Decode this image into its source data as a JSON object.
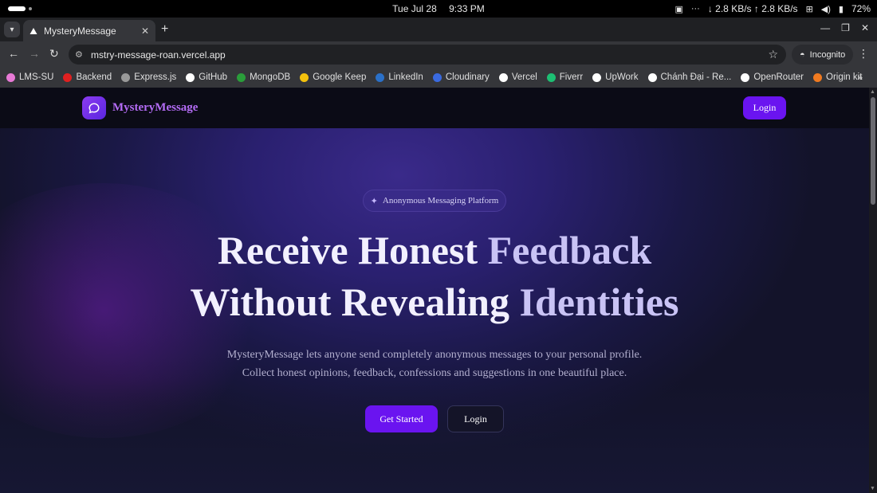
{
  "os": {
    "date": "Tue Jul 28",
    "time": "9:33 PM",
    "network_speed": "↓ 2.8 KB/s ↑ 2.8 KB/s",
    "battery": "72%"
  },
  "browser": {
    "tab_title": "MysteryMessage",
    "url": "mstry-message-roan.vercel.app",
    "incognito_label": "Incognito",
    "bookmarks": [
      {
        "label": "LMS-SU",
        "color": "#e87ad6"
      },
      {
        "label": "Backend",
        "color": "#e02020"
      },
      {
        "label": "Express.js",
        "color": "#999999"
      },
      {
        "label": "GitHub",
        "color": "#ffffff"
      },
      {
        "label": "MongoDB",
        "color": "#2a9d3a"
      },
      {
        "label": "Google Keep",
        "color": "#f4c20d"
      },
      {
        "label": "LinkedIn",
        "color": "#2a70c8"
      },
      {
        "label": "Cloudinary",
        "color": "#3a6ae0"
      },
      {
        "label": "Vercel",
        "color": "#ffffff"
      },
      {
        "label": "Fiverr",
        "color": "#1dbf73"
      },
      {
        "label": "UpWork",
        "color": "#ffffff"
      },
      {
        "label": "Chánh Đại - Re...",
        "color": "#ffffff"
      },
      {
        "label": "OpenRouter",
        "color": "#ffffff"
      },
      {
        "label": "Origin kit",
        "color": "#f07a20"
      }
    ]
  },
  "site": {
    "brand": "MysteryMessage",
    "nav_login": "Login",
    "badge": "Anonymous Messaging Platform",
    "headline_line1_a": "Receive Honest",
    "headline_line1_b": "Feedback",
    "headline_line2_a": "Without Revealing",
    "headline_line2_b": "Identities",
    "subtitle_line1": "MysteryMessage lets anyone send completely anonymous messages to your personal profile.",
    "subtitle_line2": "Collect honest opinions, feedback, confessions and suggestions in one beautiful place.",
    "cta_primary": "Get Started",
    "cta_secondary": "Login",
    "accent_color": "#6a14f0"
  }
}
